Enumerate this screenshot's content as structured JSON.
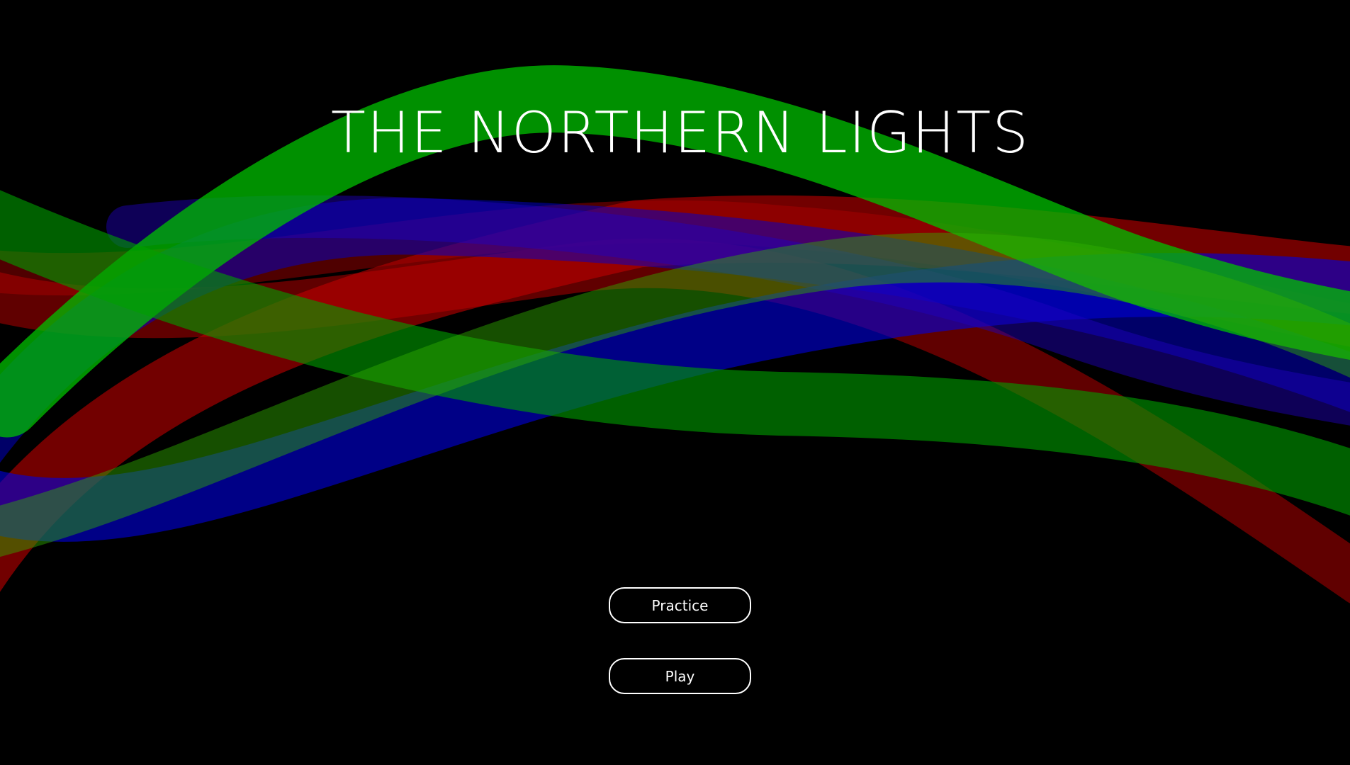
{
  "title": "THE NORTHERN LIGHTS",
  "menu": {
    "practice_label": "Practice",
    "play_label": "Play"
  },
  "colors": {
    "background": "#000000",
    "text": "#ffffff",
    "aurora_green": "#00c000",
    "aurora_red": "#d00000",
    "aurora_blue": "#0000e0"
  }
}
